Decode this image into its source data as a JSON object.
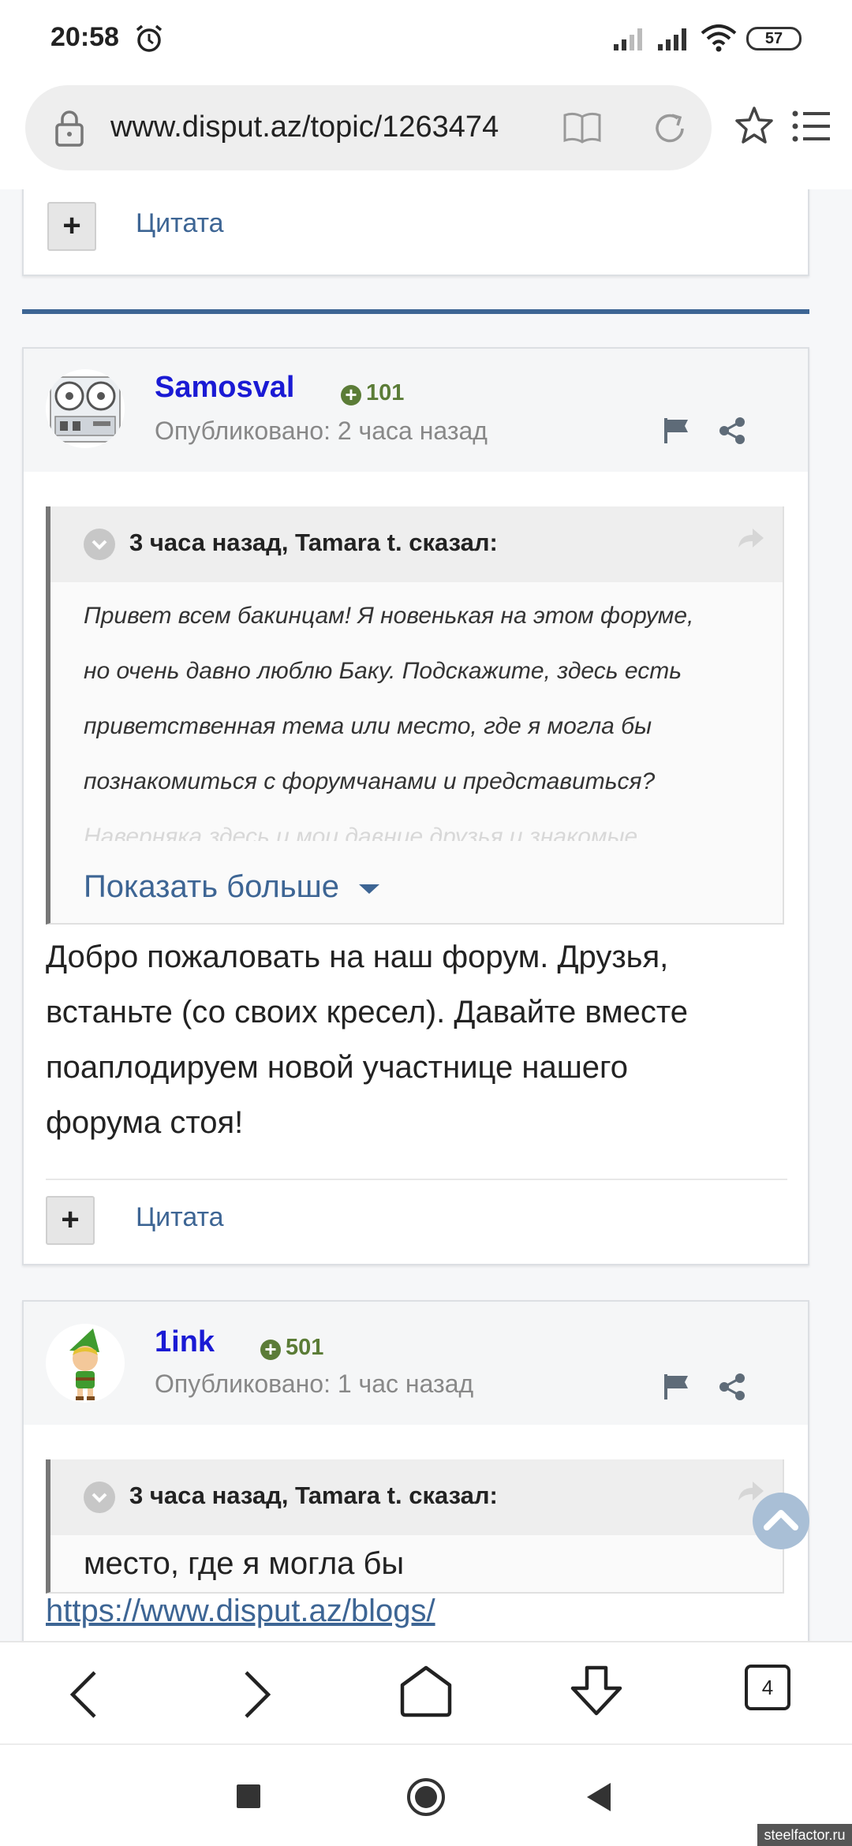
{
  "status_bar": {
    "time": "20:58",
    "battery": "57",
    "icons": [
      "alarm-icon",
      "signal-icon",
      "signal-icon",
      "wifi-icon",
      "battery-icon"
    ]
  },
  "browser": {
    "url": "www.disput.az/topic/1263474",
    "icons": [
      "lock-icon",
      "reader-mode-icon",
      "reload-icon",
      "star-icon",
      "menu-icon"
    ]
  },
  "previous_post": {
    "quote_label": "Цитата"
  },
  "posts": [
    {
      "author": "Samosval",
      "reputation": "101",
      "posted": "Опубликовано: 2 часа назад",
      "quote": {
        "header": "3 часа назад, Tamara t. сказал:",
        "lines": [
          "Привет всем бакинцам! Я новенькая на этом форуме,",
          "но очень давно люблю Баку. Подскажите, здесь есть",
          "приветственная тема или место, где я могла бы",
          "познакомиться с форумчанами и представиться?",
          "Наверняка здесь и мои давние друзья и знакомые"
        ],
        "show_more": "Показать больше"
      },
      "text_lines": [
        "Добро пожаловать на наш форум. Друзья,",
        "встаньте (со своих кресел). Давайте вместе",
        "поаплодируем новой участнице нашего",
        "форума стоя!"
      ],
      "quote_label": "Цитата"
    },
    {
      "author": "1ink",
      "reputation": "501",
      "posted": "Опубликовано: 1 час назад",
      "quote": {
        "header": "3 часа назад, Tamara t. сказал:",
        "text": "место, где я могла бы"
      },
      "link": "https://www.disput.az/blogs/"
    }
  ],
  "toolbar": {
    "tabs_count": "4",
    "icons": [
      "back-icon",
      "forward-icon",
      "home-icon",
      "download-icon",
      "tabs-icon"
    ]
  },
  "nav_bar": {
    "icons": [
      "recent-apps-icon",
      "home-circle-icon",
      "back-triangle-icon"
    ]
  },
  "watermark": "steelfactor.ru"
}
